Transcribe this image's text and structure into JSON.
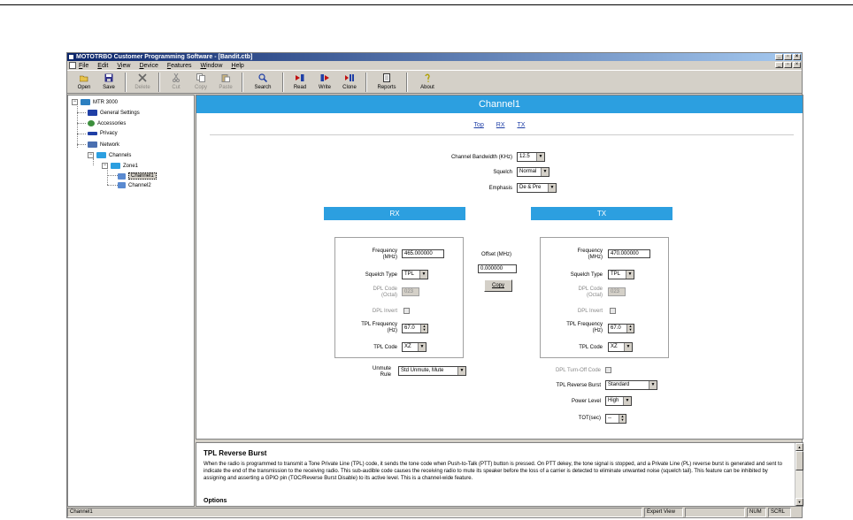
{
  "window": {
    "title": "MOTOTRBO Customer Programming Software - [Bandit.ctb]",
    "controls": [
      "_",
      "▫",
      "×"
    ]
  },
  "menu": [
    "File",
    "Edit",
    "View",
    "Device",
    "Features",
    "Window",
    "Help"
  ],
  "toolbar": [
    {
      "label": "Open",
      "icon": "folder-open-icon",
      "enabled": true
    },
    {
      "label": "Save",
      "icon": "floppy-disk-icon",
      "enabled": true
    },
    {
      "label": "Delete",
      "icon": "delete-x-icon",
      "enabled": false
    },
    {
      "label": "Cut",
      "icon": "scissors-icon",
      "enabled": false
    },
    {
      "label": "Copy",
      "icon": "copy-icon",
      "enabled": false
    },
    {
      "label": "Paste",
      "icon": "paste-icon",
      "enabled": false
    },
    {
      "label": "Search",
      "icon": "magnifier-icon",
      "enabled": true
    },
    {
      "label": "Read",
      "icon": "read-radio-icon",
      "enabled": true
    },
    {
      "label": "Write",
      "icon": "write-radio-icon",
      "enabled": true
    },
    {
      "label": "Clone",
      "icon": "clone-radio-icon",
      "enabled": true
    },
    {
      "label": "Reports",
      "icon": "report-icon",
      "enabled": true
    },
    {
      "label": "About",
      "icon": "about-icon",
      "enabled": true
    }
  ],
  "tree": {
    "root": "MTR 3000",
    "general": "General Settings",
    "accessories": "Accessories",
    "privacy": "Privacy",
    "network": "Network",
    "channels": "Channels",
    "zone": "Zone1",
    "channel1": "Channel1",
    "channel2": "Channel2"
  },
  "main": {
    "header": "Channel1",
    "links": [
      "Top",
      "RX",
      "TX"
    ],
    "bandwidth": {
      "label": "Channel Bandwidth (KHz)",
      "value": "12.5"
    },
    "squelch": {
      "label": "Squelch",
      "value": "Normal"
    },
    "emphasis": {
      "label": "Emphasis",
      "value": "De & Pre"
    },
    "rx_title": "RX",
    "tx_title": "TX",
    "rx": {
      "freq_label": "Frequency\n(MHz)",
      "freq_value": "465.000000",
      "sq_type_label": "Squelch Type",
      "sq_type_value": "TPL",
      "dpl_code_label": "DPL Code\n(Octal)",
      "dpl_code_value": "023",
      "dpl_invert_label": "DPL Invert",
      "tpl_freq_label": "TPL Frequency\n(Hz)",
      "tpl_freq_value": "67.0",
      "tpl_code_label": "TPL Code",
      "tpl_code_value": "XZ"
    },
    "offset_label": "Offset (MHz)",
    "offset_value": "0.000000",
    "copy_button": "Copy",
    "tx": {
      "freq_label": "Frequency\n(MHz)",
      "freq_value": "470.000000",
      "sq_type_label": "Squelch Type",
      "sq_type_value": "TPL",
      "dpl_code_label": "DPL Code\n(Octal)",
      "dpl_code_value": "023",
      "dpl_invert_label": "DPL Invert",
      "tpl_freq_label": "TPL Frequency\n(Hz)",
      "tpl_freq_value": "67.0",
      "tpl_code_label": "TPL Code",
      "tpl_code_value": "XZ"
    },
    "unmute_label": "Unmute\nRule",
    "unmute_value": "Std Unmute, Mute",
    "dpl_turnoff_label": "DPL Turn-Off Code",
    "tpl_reverse_label": "TPL Reverse Burst",
    "tpl_reverse_value": "Standard",
    "power_label": "Power Level",
    "power_value": "High",
    "tot_label": "TOT(sec)",
    "tot_value": "--"
  },
  "help": {
    "title": "TPL Reverse Burst",
    "body": "When the radio is programmed to transmit a Tone Private Line (TPL) code, it sends the tone code when Push-to-Talk (PTT) button is pressed. On PTT dekey, the tone signal is stopped, and a Private Line (PL) reverse burst is generated and sent to indicate the end of the transmission to the receiving radio. This sub-audible code causes the receiving radio to mute its speaker before the loss of a carrier is detected to eliminate unwanted noise (squelch tail). This feature can be inhibited by assigning and asserting a GPIO pin (TOC/Reverse Burst Disable) to its active level. This is a channel-wide feature.",
    "options": "Options"
  },
  "status": {
    "left": "Channel1",
    "view": "Expert View",
    "num": "NUM",
    "scrl": "SCRL"
  },
  "colors": {
    "accent": "#2c9fe0",
    "titlebar": "#0a246a",
    "chrome": "#d4d0c8"
  }
}
